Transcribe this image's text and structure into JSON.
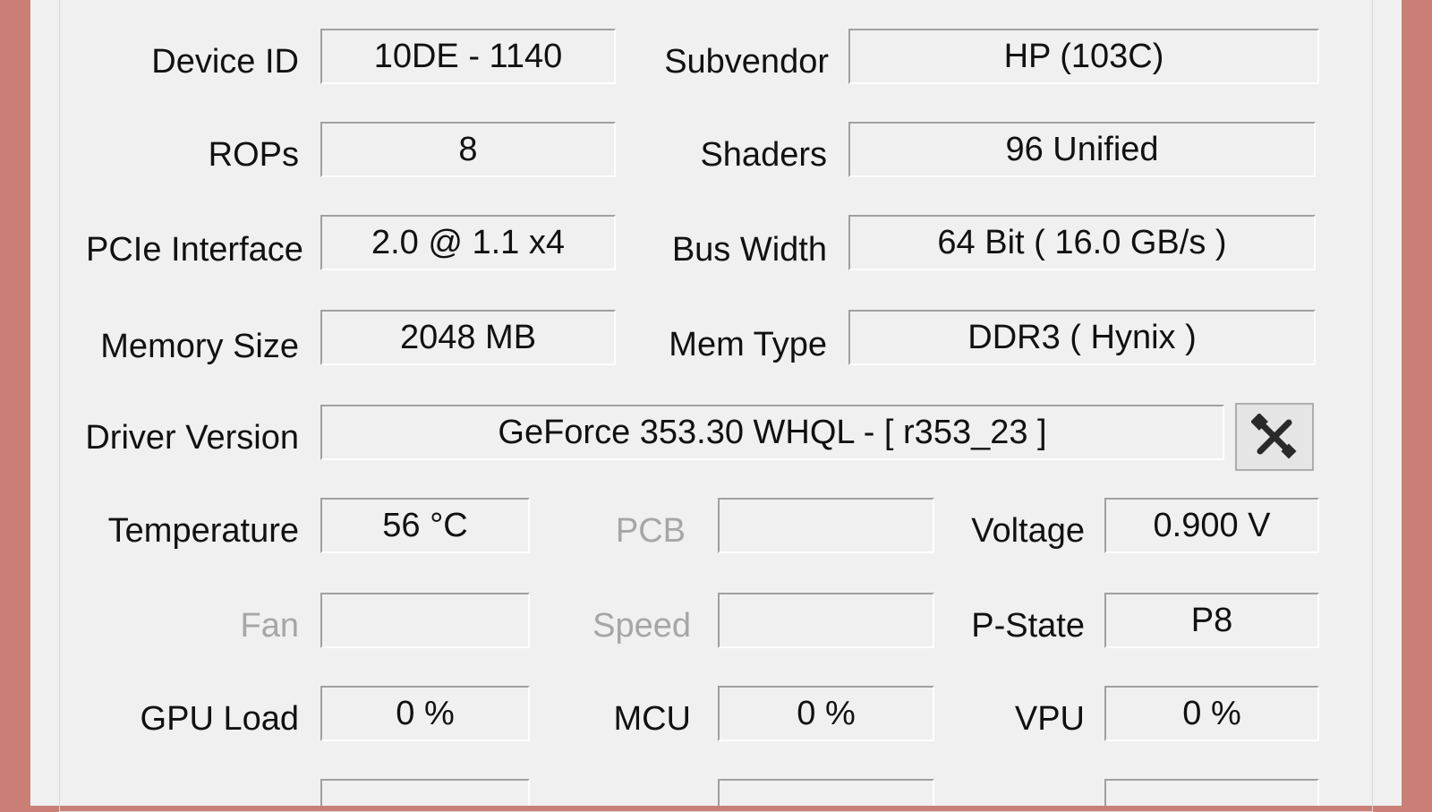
{
  "device_id": {
    "label": "Device ID",
    "value": "10DE - 1140"
  },
  "subvendor": {
    "label": "Subvendor",
    "value": "HP (103C)"
  },
  "rops": {
    "label": "ROPs",
    "value": "8"
  },
  "shaders": {
    "label": "Shaders",
    "value": "96 Unified"
  },
  "pcie_interface": {
    "label": "PCIe Interface",
    "value": "2.0 @ 1.1 x4"
  },
  "bus_width": {
    "label": "Bus Width",
    "value": "64 Bit ( 16.0 GB/s )"
  },
  "memory_size": {
    "label": "Memory Size",
    "value": "2048 MB"
  },
  "mem_type": {
    "label": "Mem Type",
    "value": "DDR3 ( Hynix )"
  },
  "driver_version": {
    "label": "Driver Version",
    "value": "GeForce 353.30 WHQL - [ r353_23 ]",
    "tool_icon": "wrench-screwdriver-icon"
  },
  "temperature": {
    "label": "Temperature",
    "value": "56 °C"
  },
  "pcb": {
    "label": "PCB",
    "value": ""
  },
  "voltage": {
    "label": "Voltage",
    "value": "0.900 V"
  },
  "fan": {
    "label": "Fan",
    "value": ""
  },
  "speed": {
    "label": "Speed",
    "value": ""
  },
  "p_state": {
    "label": "P-State",
    "value": "P8"
  },
  "gpu_load": {
    "label": "GPU Load",
    "value": "0 %"
  },
  "mcu": {
    "label": "MCU",
    "value": "0 %"
  },
  "vpu": {
    "label": "VPU",
    "value": "0 %"
  },
  "colors": {
    "frame": "#c97f76",
    "panel": "#f0f0f0",
    "disabled_text": "#a6a6a6"
  }
}
